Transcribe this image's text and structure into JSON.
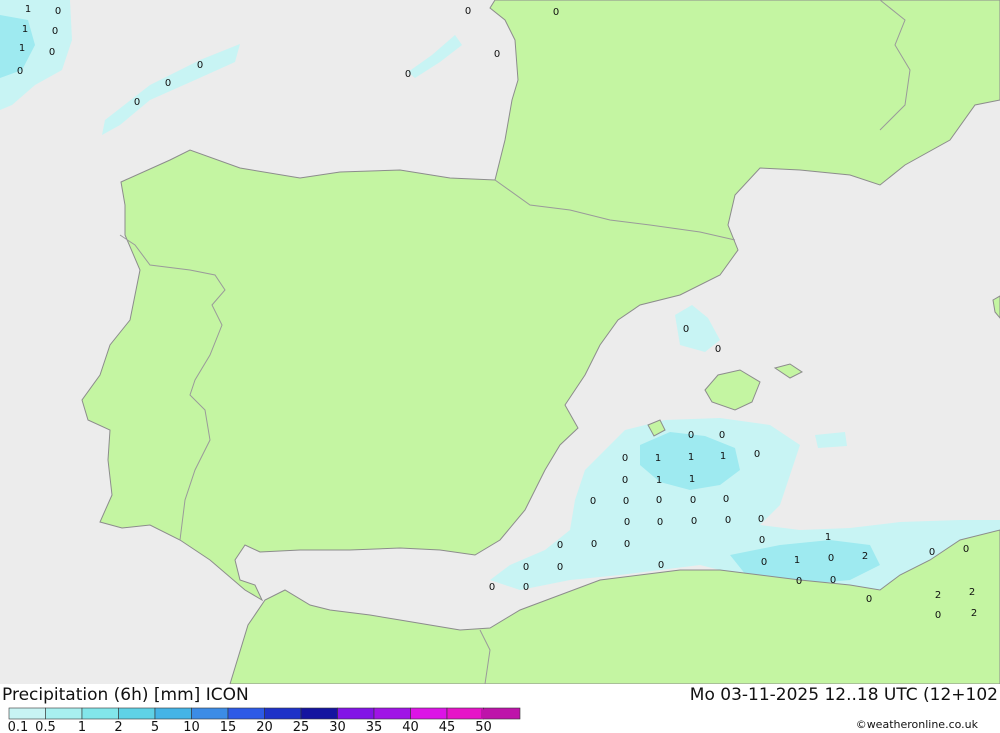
{
  "map": {
    "colors": {
      "sea": "#ececec",
      "land": "#c4f5a2",
      "border": "#9a9a9a",
      "coast": "#8c8c8c",
      "precip_light": "#c8f4f4",
      "precip_mid": "#9eeaf0",
      "precip_heavy": "#6fd8ee"
    },
    "value_labels": [
      {
        "text": "1"
      },
      {
        "text": "0"
      },
      {
        "text": "1"
      },
      {
        "text": "0"
      },
      {
        "text": "1"
      },
      {
        "text": "0"
      },
      {
        "text": "0"
      },
      {
        "text": "0"
      },
      {
        "text": "0"
      },
      {
        "text": "0"
      },
      {
        "text": "0"
      },
      {
        "text": "0"
      },
      {
        "text": "0"
      },
      {
        "text": "0"
      },
      {
        "text": "0"
      },
      {
        "text": "0"
      },
      {
        "text": "0"
      },
      {
        "text": "0"
      },
      {
        "text": "0"
      },
      {
        "text": "1"
      },
      {
        "text": "1"
      },
      {
        "text": "1"
      },
      {
        "text": "0"
      },
      {
        "text": "0"
      },
      {
        "text": "1"
      },
      {
        "text": "1"
      },
      {
        "text": "0"
      },
      {
        "text": "0"
      },
      {
        "text": "0"
      },
      {
        "text": "0"
      },
      {
        "text": "0"
      },
      {
        "text": "0"
      },
      {
        "text": "0"
      },
      {
        "text": "0"
      },
      {
        "text": "0"
      },
      {
        "text": "0"
      },
      {
        "text": "0"
      },
      {
        "text": "0"
      },
      {
        "text": "0"
      },
      {
        "text": "0"
      },
      {
        "text": "0"
      },
      {
        "text": "0"
      },
      {
        "text": "1"
      },
      {
        "text": "1"
      },
      {
        "text": "0"
      },
      {
        "text": "2"
      },
      {
        "text": "0"
      },
      {
        "text": "0"
      },
      {
        "text": "0"
      },
      {
        "text": "0"
      },
      {
        "text": "0"
      },
      {
        "text": "0"
      },
      {
        "text": "0"
      },
      {
        "text": "0"
      },
      {
        "text": "0"
      },
      {
        "text": "2"
      },
      {
        "text": "2"
      },
      {
        "text": "0"
      },
      {
        "text": "2"
      }
    ]
  },
  "legend": {
    "title": "Precipitation (6h) [mm] ICON",
    "datetime": "Mo 03-11-2025 12..18 UTC (12+102",
    "credit": "©weatheronline.co.uk",
    "scale": [
      {
        "label": "0.1",
        "color": "#c8f4f4"
      },
      {
        "label": "0.5",
        "color": "#a8f0f0"
      },
      {
        "label": "1",
        "color": "#82e6ea"
      },
      {
        "label": "2",
        "color": "#5fd2e6"
      },
      {
        "label": "5",
        "color": "#45b4e6"
      },
      {
        "label": "10",
        "color": "#3c8ce6"
      },
      {
        "label": "15",
        "color": "#2d5ae6"
      },
      {
        "label": "20",
        "color": "#1e32c8"
      },
      {
        "label": "25",
        "color": "#1414a0"
      },
      {
        "label": "30",
        "color": "#8214e6"
      },
      {
        "label": "35",
        "color": "#a014e6"
      },
      {
        "label": "40",
        "color": "#dc14e6"
      },
      {
        "label": "45",
        "color": "#e614c8"
      },
      {
        "label": "50",
        "color": "#be14aa"
      }
    ]
  }
}
